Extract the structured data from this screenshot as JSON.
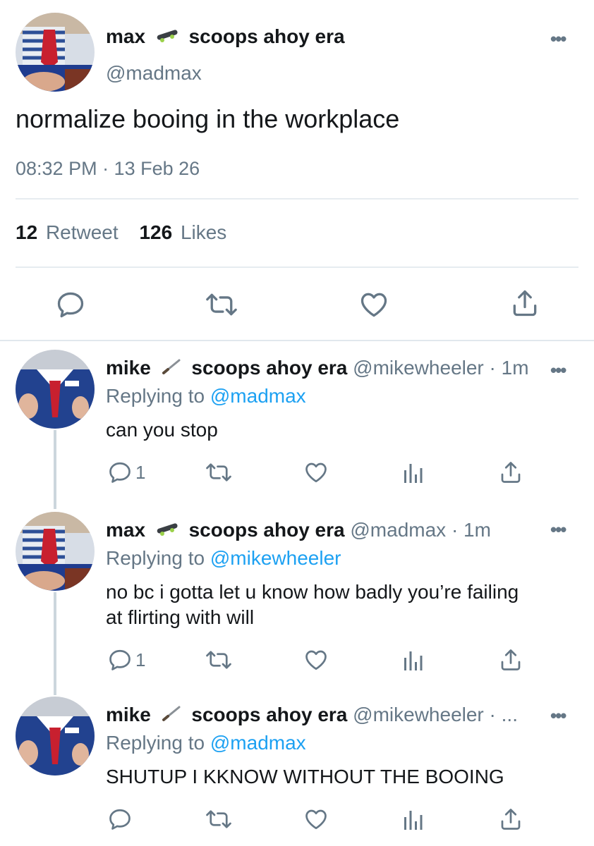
{
  "main_tweet": {
    "display_name": "max",
    "display_suffix": "scoops ahoy era",
    "handle": "@madmax",
    "more_label": "•••",
    "text": "normalize booing in the workplace",
    "timestamp": "08:32 PM · 13 Feb 26",
    "retweet_count": "12",
    "retweet_label": "Retweet",
    "likes_count": "126",
    "likes_label": "Likes"
  },
  "replies": [
    {
      "display_name": "mike",
      "display_suffix": "scoops ahoy era",
      "handle": "@mikewheeler",
      "time": "· 1m",
      "replying_prefix": "Replying to",
      "replying_to": "@madmax",
      "text": "can you stop",
      "reply_count": "1",
      "more_label": "•••"
    },
    {
      "display_name": "max",
      "display_suffix": "scoops ahoy era",
      "handle": "@madmax",
      "time": "· 1m",
      "replying_prefix": "Replying to",
      "replying_to": "@mikewheeler",
      "text_line1": "no bc i gotta let u know how badly you’re failing",
      "text_line2": "at flirting with will",
      "reply_count": "1",
      "more_label": "•••"
    },
    {
      "display_name": "mike",
      "display_suffix": "scoops ahoy era",
      "handle": "@mikewheeler",
      "time": "· ...",
      "replying_prefix": "Replying to",
      "replying_to": "@madmax",
      "text": "SHUTUP I KKNOW WITHOUT THE BOOING",
      "reply_count": "",
      "more_label": "•••"
    }
  ],
  "colors": {
    "accent": "#1da1f2",
    "muted": "#657786",
    "divider": "#e6ecf0",
    "thread_line": "#ccd6dd"
  },
  "icons": [
    "reply-icon",
    "retweet-icon",
    "like-icon",
    "share-icon",
    "analytics-icon",
    "skateboard-icon",
    "knife-icon"
  ]
}
